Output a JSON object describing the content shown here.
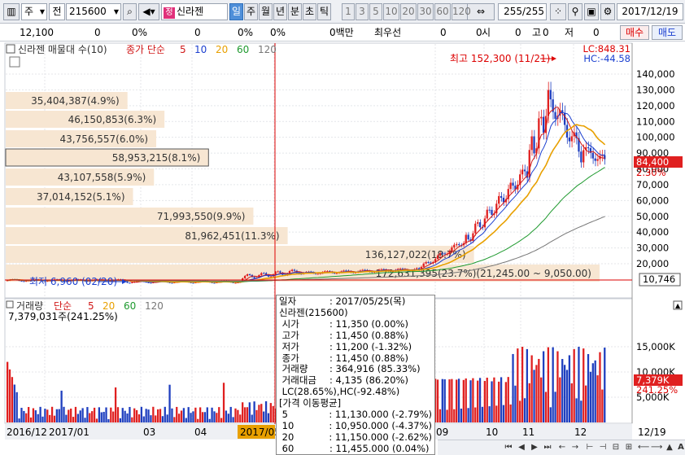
{
  "toolbar": {
    "market": "주",
    "type": "전",
    "code": "215600",
    "name": "신라젠",
    "name_badge": "정",
    "periods": [
      "일",
      "주",
      "월",
      "년",
      "분",
      "초",
      "틱"
    ],
    "selected_period": "일",
    "nums": [
      "1",
      "3",
      "5",
      "10",
      "20",
      "30",
      "60",
      "120"
    ],
    "count": "255",
    "count_total": "/255",
    "date": "2017/12/19"
  },
  "info": {
    "cells": [
      "12,100",
      "0",
      "0%",
      "0",
      "0%",
      "0%",
      "0백만",
      "최우선",
      "0",
      "0",
      "시",
      "0",
      "고",
      "0",
      "저",
      "0"
    ],
    "buy_button": "매수",
    "sell_button": "매도"
  },
  "price_pane": {
    "legend_name": "신라젠 매물대 수(10)",
    "legend_ma": "종가 단순",
    "ma_periods": [
      "5",
      "10",
      "20",
      "60",
      "120"
    ],
    "lc_label": "LC:848.31",
    "hc_label": "HC:-44.58",
    "high_annotation": "최고 152,300 (11/21)",
    "low_annotation": "최저 6,960 (02/20)",
    "current_price": "84,400",
    "current_change": "2.30%",
    "hover_value": "10,746",
    "y_ticks": [
      "140,000",
      "130,000",
      "120,000",
      "110,000",
      "100,000",
      "90,000",
      "80,000",
      "70,000",
      "60,000",
      "50,000",
      "40,000",
      "30,000",
      "20,000"
    ],
    "volume_profile": [
      {
        "label": "172,631,395(23.7%)(21,245.00 ~ 9,050.00)",
        "value": 172631395,
        "pct": 23.7
      },
      {
        "label": "136,127,022(18.7%)",
        "value": 136127022,
        "pct": 18.7
      },
      {
        "label": "81,962,451(11.3%)",
        "value": 81962451,
        "pct": 11.3
      },
      {
        "label": "71,993,550(9.9%)",
        "value": 71993550,
        "pct": 9.9
      },
      {
        "label": "37,014,152(5.1%)",
        "value": 37014152,
        "pct": 5.1
      },
      {
        "label": "43,107,558(5.9%)",
        "value": 43107558,
        "pct": 5.9
      },
      {
        "label": "58,953,215(8.1%)",
        "value": 58953215,
        "pct": 8.1
      },
      {
        "label": "43,756,557(6.0%)",
        "value": 43756557,
        "pct": 6.0
      },
      {
        "label": "46,150,853(6.3%)",
        "value": 46150853,
        "pct": 6.3
      },
      {
        "label": "35,404,387(4.9%)",
        "value": 35404387,
        "pct": 4.9
      }
    ]
  },
  "volume_pane": {
    "legend_name": "거래량",
    "legend_ma": "단순",
    "ma_periods": [
      "5",
      "20",
      "60",
      "120"
    ],
    "summary": "7,379,031주(241.25%)",
    "y_ticks": [
      "15,000K",
      "10,000K",
      "5,000K"
    ],
    "current_volume": "7,379K",
    "current_pct": "241.25%"
  },
  "x_axis": {
    "labels": [
      "2016/12",
      "2017/01",
      "03",
      "04",
      "2017/05",
      "09",
      "10",
      "11",
      "12",
      "12/19"
    ]
  },
  "tooltip": {
    "rows": [
      {
        "k": "일자",
        "v": ": 2017/05/25(목)"
      },
      {
        "k": "신라젠(215600)",
        "v": ""
      },
      {
        "k": " 시가",
        "v": ": 11,350 (0.00%)"
      },
      {
        "k": " 고가",
        "v": ": 11,450 (0.88%)"
      },
      {
        "k": " 저가",
        "v": ": 11,200 (-1.32%)"
      },
      {
        "k": " 종가",
        "v": ": 11,450 (0.88%)"
      },
      {
        "k": " 거래량",
        "v": ": 364,916 (85.33%)"
      },
      {
        "k": " 거래대금",
        "v": ": 4,135 (86.20%)"
      },
      {
        "k": " LC(28.65%),HC(-92.48%)",
        "v": ""
      },
      {
        "k": "[가격 이동평균]",
        "v": ""
      },
      {
        "k": " 5",
        "v": ": 11,130.000 (-2.79%)"
      },
      {
        "k": " 10",
        "v": ": 10,950.000 (-4.37%)"
      },
      {
        "k": " 20",
        "v": ": 11,150.000 (-2.62%)"
      },
      {
        "k": " 60",
        "v": ": 11,455.000 (0.04%)"
      }
    ]
  },
  "colors": {
    "up": "#e02020",
    "down": "#1f3fbf",
    "ma5": "#d01818",
    "ma10": "#1c3fcf",
    "ma20": "#e8a000",
    "ma60": "#1f9a2f",
    "ma120": "#777777",
    "profile": "#f7e6d2"
  }
}
